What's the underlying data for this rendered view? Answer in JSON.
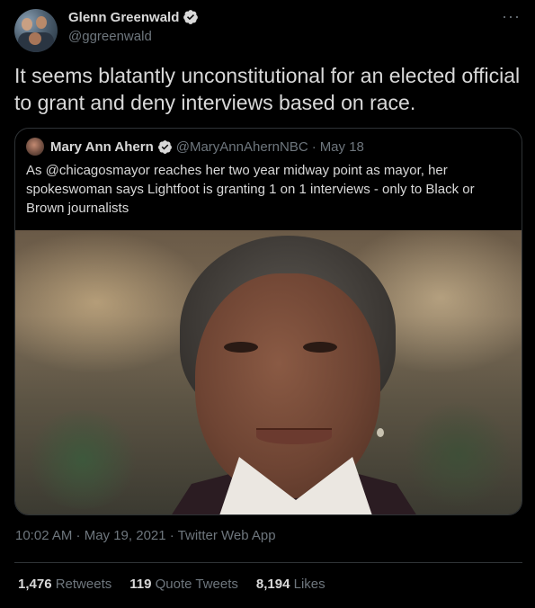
{
  "author": {
    "display_name": "Glenn Greenwald",
    "handle": "@ggreenwald",
    "verified": true
  },
  "more_icon": "more-horizontal-icon",
  "tweet": {
    "text": "It seems blatantly unconstitutional for an elected official to grant and deny interviews based on race."
  },
  "quoted": {
    "display_name": "Mary Ann Ahern",
    "handle": "@MaryAnnAhernNBC",
    "separator": "·",
    "date": "May 18",
    "text": "As @chicagosmayor reaches her two year midway point as mayor, her spokeswoman says Lightfoot is granting 1 on 1 interviews - only to Black or Brown journalists",
    "image_subject": "portrait-photo"
  },
  "meta": {
    "text": "10:02 AM · May 19, 2021 · Twitter Web App"
  },
  "stats": [
    {
      "count": "1,476",
      "label": "Retweets"
    },
    {
      "count": "119",
      "label": "Quote Tweets"
    },
    {
      "count": "8,194",
      "label": "Likes"
    }
  ],
  "colors": {
    "background": "#000000",
    "text_primary": "#d9d9d9",
    "text_secondary": "#6e767d",
    "border": "#2f3336",
    "verified_badge": "#d9d9d9"
  }
}
